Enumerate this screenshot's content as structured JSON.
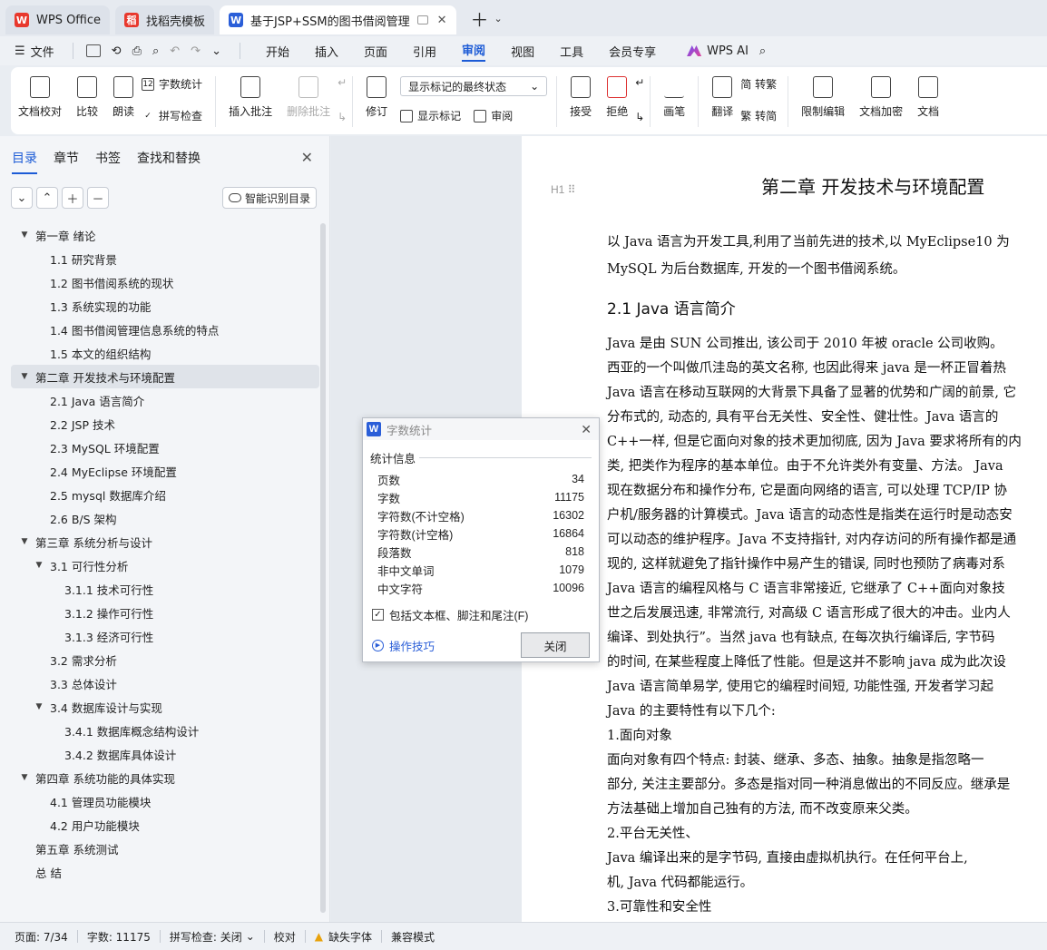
{
  "tabs": [
    {
      "label": "WPS Office",
      "icon": "wps-logo-icon",
      "color": "#e8382d"
    },
    {
      "label": "找稻壳模板",
      "icon": "docer-icon",
      "color": "#e8382d"
    },
    {
      "label": "基于JSP+SSM的图书借阅管理",
      "icon": "word-doc-icon",
      "color": "#2a5ed8"
    }
  ],
  "menubar": {
    "file": "文件",
    "tabs": [
      "开始",
      "插入",
      "页面",
      "引用",
      "审阅",
      "视图",
      "工具",
      "会员专享"
    ],
    "active_tab": "审阅",
    "wps_ai": "WPS AI"
  },
  "ribbon": {
    "doc_check": "文档校对",
    "compare": "比较",
    "read_aloud": "朗读",
    "word_count": "字数统计",
    "spell_check": "拼写检查",
    "insert_comment": "插入批注",
    "delete_comment": "删除批注",
    "track_changes": "修订",
    "markup_state": "显示标记的最终状态",
    "show_markup": "显示标记",
    "review_pane": "审阅",
    "accept": "接受",
    "reject": "拒绝",
    "pen": "画笔",
    "translate": "翻译",
    "to_traditional": "简 转繁",
    "to_simplified": "繁 转简",
    "restrict_edit": "限制编辑",
    "doc_encrypt": "文档加密",
    "doc_more": "文档"
  },
  "nav": {
    "tabs": [
      "目录",
      "章节",
      "书签",
      "查找和替换"
    ],
    "smart_toc": "智能识别目录",
    "toc": [
      {
        "label": "第一章  绪论",
        "level": 0,
        "expand": true
      },
      {
        "label": "1.1    研究背景",
        "level": 1
      },
      {
        "label": "1.2    图书借阅系统的现状",
        "level": 1
      },
      {
        "label": "1.3    系统实现的功能",
        "level": 1
      },
      {
        "label": "1.4    图书借阅管理信息系统的特点",
        "level": 1
      },
      {
        "label": "1.5    本文的组织结构",
        "level": 1
      },
      {
        "label": "第二章  开发技术与环境配置",
        "level": 0,
        "expand": true,
        "selected": true
      },
      {
        "label": "2.1    Java 语言简介",
        "level": 1
      },
      {
        "label": " 2.2    JSP 技术",
        "level": 1
      },
      {
        "label": "2.3    MySQL 环境配置",
        "level": 1
      },
      {
        "label": "2.4    MyEclipse 环境配置",
        "level": 1
      },
      {
        "label": "2.5    mysql 数据库介绍",
        "level": 1
      },
      {
        "label": "2.6    B/S 架构",
        "level": 1
      },
      {
        "label": "第三章  系统分析与设计",
        "level": 0,
        "expand": true
      },
      {
        "label": "3.1  可行性分析",
        "level": 1,
        "expand": true
      },
      {
        "label": "3.1.1  技术可行性",
        "level": 2
      },
      {
        "label": "3.1.2  操作可行性",
        "level": 2
      },
      {
        "label": "3.1.3 经济可行性",
        "level": 2
      },
      {
        "label": "3.2    需求分析",
        "level": 1
      },
      {
        "label": "3.3    总体设计",
        "level": 1
      },
      {
        "label": "3.4    数据库设计与实现",
        "level": 1,
        "expand": true
      },
      {
        "label": "3.4.1    数据库概念结构设计",
        "level": 2
      },
      {
        "label": "3.4.2  数据库具体设计",
        "level": 2
      },
      {
        "label": "第四章    系统功能的具体实现",
        "level": 0,
        "expand": true
      },
      {
        "label": "4.1 管理员功能模块",
        "level": 1
      },
      {
        "label": "4.2  用户功能模块",
        "level": 1
      },
      {
        "label": "第五章  系统测试",
        "level": 0
      },
      {
        "label": " 总 结",
        "level": 0
      }
    ]
  },
  "document": {
    "chapter_title": "第二章  开发技术与环境配置",
    "heading_marker": "H1",
    "intro": [
      "    以 Java 语言为开发工具,利用了当前先进的技术,以 MyEclipse10 为",
      "MySQL 为后台数据库, 开发的一个图书借阅系统。"
    ],
    "section_title": "2.1    Java 语言简介",
    "body": [
      "    Java 是由 SUN 公司推出, 该公司于 2010 年被 oracle 公司收购。",
      "西亚的一个叫做爪洼岛的英文名称, 也因此得来 java 是一杯正冒着热",
      "Java 语言在移动互联网的大背景下具备了显著的优势和广阔的前景, 它",
      "分布式的, 动态的, 具有平台无关性、安全性、健壮性。Java 语言的",
      "C++一样, 但是它面向对象的技术更加彻底, 因为 Java 要求将所有的内",
      "类, 把类作为程序的基本单位。由于不允许类外有变量、方法。  Java",
      "现在数据分布和操作分布, 它是面向网络的语言, 可以处理 TCP/IP 协",
      "户机/服务器的计算模式。Java 语言的动态性是指类在运行时是动态安",
      "可以动态的维护程序。Java 不支持指针, 对内存访问的所有操作都是通",
      "现的, 这样就避免了指针操作中易产生的错误, 同时也预防了病毒对系",
      "    Java 语言的编程风格与 C 语言非常接近, 它继承了 C++面向对象技",
      "世之后发展迅速, 非常流行, 对高级 C 语言形成了很大的冲击。业内人",
      "编译、到处执行”。当然 java 也有缺点, 在每次执行编译后, 字节码",
      "的时间, 在某些程度上降低了性能。但是这并不影响 java 成为此次设",
      "Java 语言简单易学, 使用它的编程时间短, 功能性强, 开发者学习起",
      "Java 的主要特性有以下几个:",
      "    1.面向对象",
      "    面向对象有四个特点: 封装、继承、多态、抽象。抽象是指忽略一",
      "部分, 关注主要部分。多态是指对同一种消息做出的不同反应。继承是",
      "方法基础上增加自己独有的方法, 而不改变原来父类。",
      "    2.平台无关性、",
      "    Java 编译出来的是字节码, 直接由虚拟机执行。在任何平台上,",
      "机, Java 代码都能运行。",
      "    3.可靠性和安全性"
    ]
  },
  "dialog": {
    "title": "字数统计",
    "group": "统计信息",
    "stats": [
      {
        "label": "页数",
        "value": "34"
      },
      {
        "label": "字数",
        "value": "11175"
      },
      {
        "label": "字符数(不计空格)",
        "value": "16302"
      },
      {
        "label": "字符数(计空格)",
        "value": "16864"
      },
      {
        "label": "段落数",
        "value": "818"
      },
      {
        "label": "非中文单词",
        "value": "1079"
      },
      {
        "label": "中文字符",
        "value": "10096"
      }
    ],
    "include_label": "包括文本框、脚注和尾注(F)",
    "include_checked": true,
    "tips": "操作技巧",
    "close": "关闭"
  },
  "statusbar": {
    "page": "页面: 7/34",
    "words": "字数: 11175",
    "spell": "拼写检查: 关闭",
    "proof": "校对",
    "missing_font": "缺失字体",
    "compat": "兼容模式"
  }
}
